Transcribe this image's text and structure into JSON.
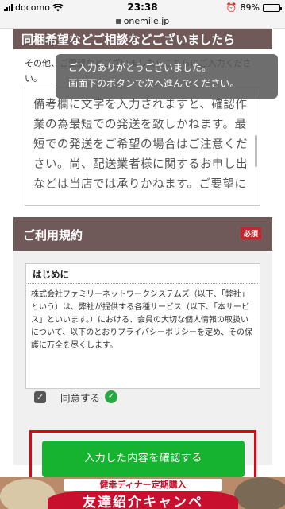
{
  "status_bar": {
    "carrier": "docomo",
    "time": "23:38",
    "battery": "89%",
    "battery_level": 0.89
  },
  "browser": {
    "url": "onemile.jp"
  },
  "top_section": {
    "header_partial": "同梱希望などご相談などございましたら",
    "note": "その他、ご要望などございましたらこちらにご入力ください。",
    "remarks_text": "備考欄に文字を入力されますと、確認作業の為最短での発送を致しかねます。最短での発送をご希望の場合はご注意ください。尚、配送業者様に関するお申し出などは当店では承りかねます。ご要望に"
  },
  "toast": {
    "line1": "ご入力ありがとうございました。",
    "line2": "画面下のボタンで次へ進んでください。"
  },
  "terms_section": {
    "title": "ご利用規約",
    "required_badge": "必須",
    "box_title": "はじめに",
    "box_text": "株式会社ファミリーネットワークシステムズ（以下、「弊社」という）は、弊社が提供する各種サービス（以下、「本サービス」といいます。）における、会員の大切な個人情報の取扱いについて、以下のとおりプライバシーポリシーを定め、その保護に万全を尽くします。",
    "agree_label": "同意する",
    "agree_checked": true
  },
  "submit": {
    "label": "入力した内容を確認する"
  },
  "banner": {
    "subtitle": "健幸ディナー定期購入",
    "title": "友達紹介キャンペ"
  },
  "colors": {
    "section_header": "#6f5a59",
    "required": "#c1272d",
    "submit": "#16b330",
    "highlight_frame": "#e60012"
  }
}
